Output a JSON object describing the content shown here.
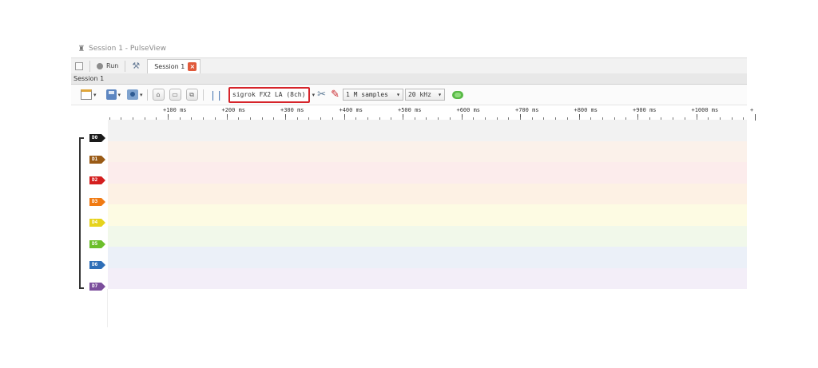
{
  "window": {
    "title": "Session 1 - PulseView",
    "app_icon": "pulseview-icon"
  },
  "tabbar": {
    "run_label": "Run",
    "session_tab_label": "Session 1",
    "close_glyph": "×"
  },
  "session_header": {
    "label": "Session 1"
  },
  "toolbar": {
    "device": "sigrok FX2 LA (8ch)",
    "samples": "1 M samples",
    "samplerate": "20 kHz",
    "zoom_in_glyph": "⌂",
    "zoom_out_glyph": "▭",
    "zoom_fit_glyph": "⧉",
    "cursor_glyph": "❘❘",
    "wrench_glyph": "✂",
    "probe_glyph": "✎",
    "dropdown_glyph": "▾"
  },
  "ruler": {
    "ticks": [
      "+100 ms",
      "+200 ms",
      "+300 ms",
      "+400 ms",
      "+500 ms",
      "+600 ms",
      "+700 ms",
      "+800 ms",
      "+900 ms",
      "+1000 ms",
      "+"
    ]
  },
  "channels": [
    {
      "name": "D0",
      "color": "#1a1a1a",
      "lane_color": "#f2f2f2"
    },
    {
      "name": "D1",
      "color": "#9a5b16",
      "lane_color": "#fbf1ea"
    },
    {
      "name": "D2",
      "color": "#d41f1f",
      "lane_color": "#fcecec"
    },
    {
      "name": "D3",
      "color": "#f07a12",
      "lane_color": "#fdf1e4"
    },
    {
      "name": "D4",
      "color": "#e6d31c",
      "lane_color": "#fdfbe3"
    },
    {
      "name": "D5",
      "color": "#6cbf2b",
      "lane_color": "#f1f8ea"
    },
    {
      "name": "D6",
      "color": "#2f6fb8",
      "lane_color": "#ebf0f8"
    },
    {
      "name": "D7",
      "color": "#7b4e9c",
      "lane_color": "#f3eef8"
    }
  ]
}
